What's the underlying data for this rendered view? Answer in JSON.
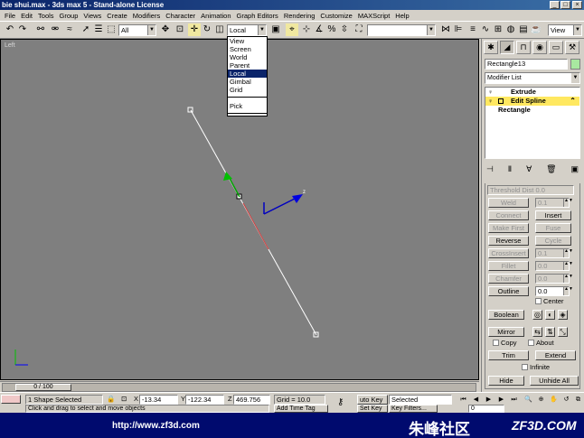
{
  "window": {
    "title": "bie shui.max - 3ds max 5 - Stand-alone License"
  },
  "menu": [
    "File",
    "Edit",
    "Tools",
    "Group",
    "Views",
    "Create",
    "Modifiers",
    "Character",
    "Animation",
    "Graph Editors",
    "Rendering",
    "Customize",
    "MAXScript",
    "Help"
  ],
  "toolbar": {
    "selection_filter": "All",
    "ref_coord": "Local",
    "named_selection": "",
    "view_combo": "View"
  },
  "coord_dropdown": {
    "items": [
      "View",
      "Screen",
      "World",
      "Parent",
      "Local",
      "Gimbal",
      "Grid",
      "Pick"
    ],
    "selected": "Local"
  },
  "viewport": {
    "label": "Left"
  },
  "command_panel": {
    "object_name": "Rectangle13",
    "object_color": "#a8e8a0",
    "modifier_list": "Modifier List",
    "stack": [
      {
        "label": "Extrude",
        "selected": false
      },
      {
        "label": "Edit Spline",
        "selected": true
      },
      {
        "label": "Rectangle",
        "selected": false
      }
    ],
    "rollout_header": "Threshold Dist",
    "rollout_header_value": "0.0",
    "buttons": {
      "weld": "Weld",
      "weld_value": "0.1",
      "connect": "Connect",
      "insert": "Insert",
      "make_first": "Make First",
      "fuse": "Fuse",
      "reverse": "Reverse",
      "cycle": "Cycle",
      "cross_insert": "CrossInsert",
      "cross_insert_value": "0.1",
      "fillet": "Fillet",
      "fillet_value": "0.0",
      "chamfer": "Chamfer",
      "chamfer_value": "0.0",
      "outline": "Outline",
      "outline_value": "0.0",
      "center": "Center",
      "boolean": "Boolean",
      "mirror": "Mirror",
      "copy": "Copy",
      "about": "About",
      "trim": "Trim",
      "extend": "Extend",
      "infinite": "Infinite",
      "hide": "Hide",
      "unhide_all": "Unhide All"
    }
  },
  "time_slider": {
    "label": "0 / 100"
  },
  "status": {
    "selection": "1 Shape Selected",
    "prompt": "Click and drag to select and move objects",
    "x_label": "X",
    "x": "-13.34",
    "y_label": "Y",
    "y": "-122.34",
    "z_label": "Z",
    "z": "469.756",
    "grid": "Grid = 10.0",
    "auto_key": "uto Key",
    "set_key": "Set Key",
    "selected_combo": "Selected",
    "key_filters": "Key Filters...",
    "add_time_tag": "Add Time Tag",
    "frame": "0"
  },
  "banner": {
    "url": "http://www.zf3d.com",
    "cn": "朱峰社区",
    "brand": "ZF3D.COM"
  }
}
